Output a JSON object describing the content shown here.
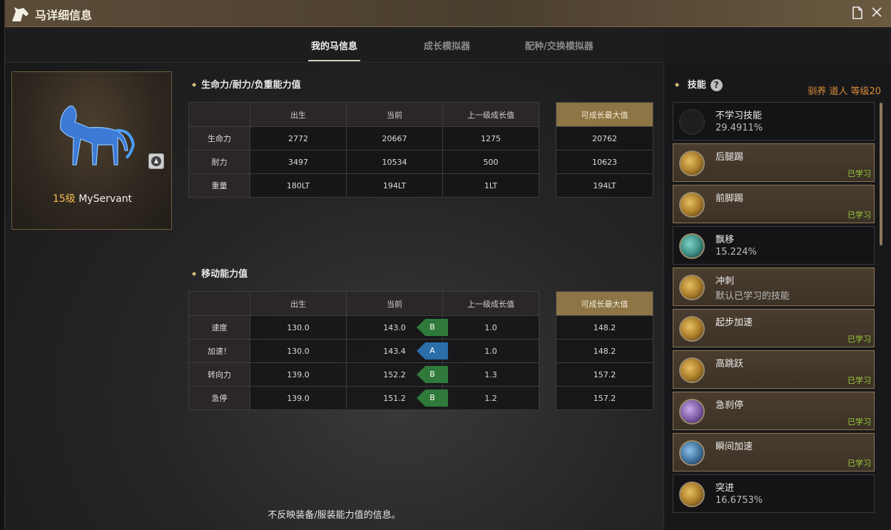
{
  "window": {
    "title": "马详细信息"
  },
  "tabs": [
    {
      "label": "我的马信息",
      "active": true
    },
    {
      "label": "成长模拟器",
      "active": false
    },
    {
      "label": "配种/交换模拟器",
      "active": false
    }
  ],
  "horse": {
    "level": "15级",
    "name": "MyServant"
  },
  "stats_section": {
    "title": "生命力/耐力/负重能力值",
    "headers": [
      "出生",
      "当前",
      "上一级成长值",
      "可成长最大值"
    ],
    "rows": [
      {
        "label": "生命力",
        "birth": "2772",
        "current": "20667",
        "last_growth": "1275",
        "max": "20762"
      },
      {
        "label": "耐力",
        "birth": "3497",
        "current": "10534",
        "last_growth": "500",
        "max": "10623"
      },
      {
        "label": "重量",
        "birth": "180LT",
        "current": "194LT",
        "last_growth": "1LT",
        "max": "194LT"
      }
    ]
  },
  "move_section": {
    "title": "移动能力值",
    "headers": [
      "出生",
      "当前",
      "上一级成长值",
      "可成长最大值"
    ],
    "rows": [
      {
        "label": "速度",
        "birth": "130.0",
        "current": "143.0",
        "grade": "B",
        "last_growth": "1.0",
        "max": "148.2"
      },
      {
        "label": "加速！",
        "birth": "130.0",
        "current": "143.4",
        "grade": "A",
        "last_growth": "1.0",
        "max": "148.2"
      },
      {
        "label": "转向力",
        "birth": "139.0",
        "current": "152.2",
        "grade": "B",
        "last_growth": "1.3",
        "max": "157.2"
      },
      {
        "label": "急停",
        "birth": "139.0",
        "current": "151.2",
        "grade": "B",
        "last_growth": "1.2",
        "max": "157.2"
      }
    ]
  },
  "footer_note": "不反映装备/服装能力值的信息。",
  "skills": {
    "title": "技能",
    "training": "驯养 道人 等级20",
    "items": [
      {
        "name": "不学习技能",
        "sub": "29.4911%",
        "learned": "",
        "icon": "none"
      },
      {
        "name": "后腿踢",
        "sub": "",
        "learned": "已学习",
        "icon": "gold"
      },
      {
        "name": "前脚踢",
        "sub": "",
        "learned": "已学习",
        "icon": "gold"
      },
      {
        "name": "飘移",
        "sub": "15.224%",
        "learned": "",
        "icon": "teal"
      },
      {
        "name": "冲刺",
        "sub": "默认已学习的技能",
        "learned": "",
        "icon": "gold"
      },
      {
        "name": "起步加速",
        "sub": "",
        "learned": "已学习",
        "icon": "gold"
      },
      {
        "name": "高跳跃",
        "sub": "",
        "learned": "已学习",
        "icon": "gold"
      },
      {
        "name": "急刹停",
        "sub": "",
        "learned": "已学习",
        "icon": "violet"
      },
      {
        "name": "瞬间加速",
        "sub": "",
        "learned": "已学习",
        "icon": "blue"
      },
      {
        "name": "突进",
        "sub": "16.6753%",
        "learned": "",
        "icon": "gold"
      }
    ]
  },
  "colors": {
    "accent_gold": "#8d7545",
    "grade_b": "#2f7a3a",
    "grade_a": "#2a6eaa",
    "learned_green": "#9ccf3c",
    "training_orange": "#d98b3a"
  }
}
